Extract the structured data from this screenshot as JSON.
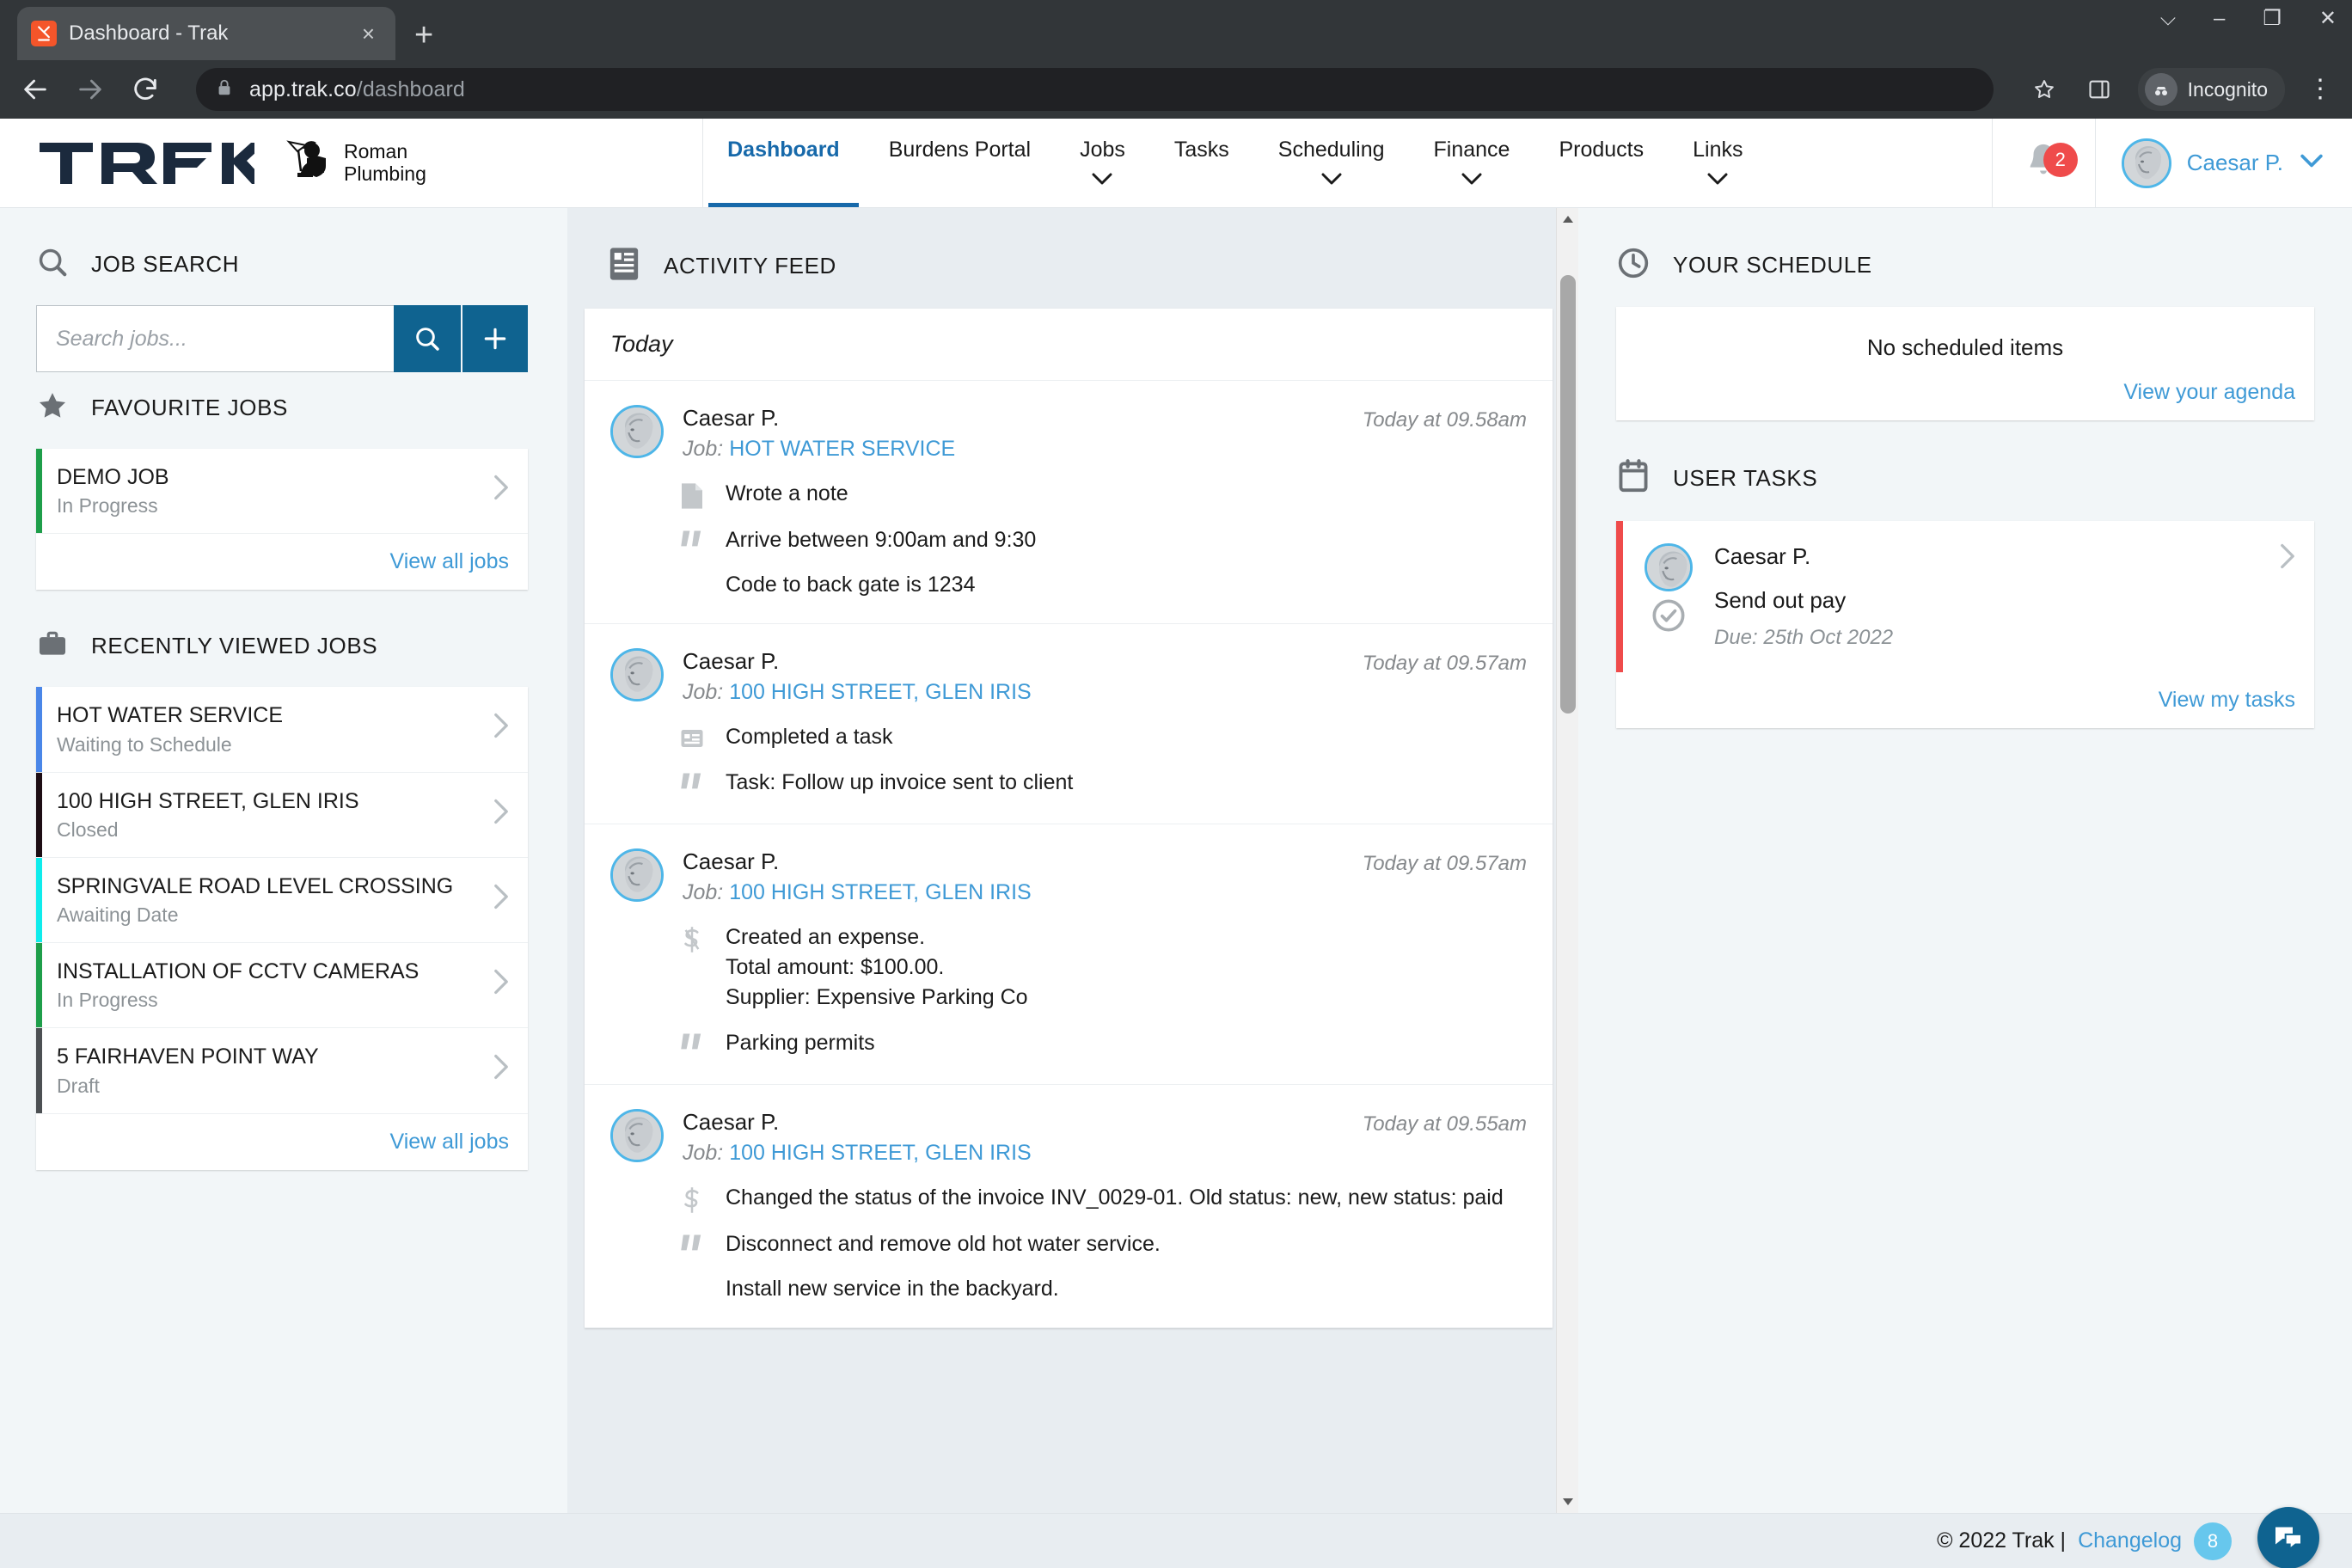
{
  "browser": {
    "tab_title": "Dashboard - Trak",
    "favicon": "trak-favicon",
    "new_tab_label": "+",
    "close_label": "×",
    "url_host": "app.trak.co",
    "url_path": "/dashboard",
    "profile_label": "Incognito",
    "win_minimize": "–",
    "win_maximize": "❐",
    "win_close": "✕",
    "win_collapse": "⌵"
  },
  "header": {
    "logo_text": "TRAK",
    "company_line1": "Roman",
    "company_line2": "Plumbing",
    "nav": [
      {
        "label": "Dashboard",
        "chevron": false,
        "active": true
      },
      {
        "label": "Burdens Portal",
        "chevron": false,
        "active": false
      },
      {
        "label": "Jobs",
        "chevron": true,
        "active": false
      },
      {
        "label": "Tasks",
        "chevron": false,
        "active": false
      },
      {
        "label": "Scheduling",
        "chevron": true,
        "active": false
      },
      {
        "label": "Finance",
        "chevron": true,
        "active": false
      },
      {
        "label": "Products",
        "chevron": false,
        "active": false
      },
      {
        "label": "Links",
        "chevron": true,
        "active": false
      }
    ],
    "notification_count": "2",
    "user_name": "Caesar P.",
    "user_chevron": "⌄",
    "accent_blue": "#1769aa",
    "link_blue": "#3f9ad6",
    "badge_red": "#ef4b4b"
  },
  "sidebar": {
    "job_search": {
      "title": "JOB SEARCH",
      "placeholder": "Search jobs...",
      "search_button": "search-icon",
      "add_button": "+"
    },
    "favourite_jobs": {
      "title": "FAVOURITE JOBS",
      "items": [
        {
          "name": "DEMO JOB",
          "status": "In Progress",
          "color": "#1e9e4a"
        }
      ],
      "view_all": "View all jobs"
    },
    "recently_viewed": {
      "title": "RECENTLY VIEWED JOBS",
      "items": [
        {
          "name": "HOT WATER SERVICE",
          "status": "Waiting to Schedule",
          "color": "#4a86e8"
        },
        {
          "name": "100 HIGH STREET, GLEN IRIS",
          "status": "Closed",
          "color": "#1d0d14"
        },
        {
          "name": "SPRINGVALE ROAD LEVEL CROSSING",
          "status": "Awaiting Date",
          "color": "#0fecec"
        },
        {
          "name": "INSTALLATION OF CCTV CAMERAS",
          "status": "In Progress",
          "color": "#1e9e4a"
        },
        {
          "name": "5 FAIRHAVEN POINT WAY",
          "status": "Draft",
          "color": "#4c5053"
        }
      ],
      "view_all": "View all jobs"
    }
  },
  "activity_feed": {
    "title": "ACTIVITY FEED",
    "day_label": "Today",
    "job_prefix": "Job:",
    "items": [
      {
        "user": "Caesar P.",
        "job": "HOT WATER SERVICE",
        "time": "Today at 09.58am",
        "action_icon": "note-icon",
        "action": "Wrote a note",
        "quote_icon": "quote-icon",
        "quote": "Arrive between 9:00am and 9:30",
        "extra": "Code to back gate is 1234"
      },
      {
        "user": "Caesar P.",
        "job": "100 HIGH STREET, GLEN IRIS",
        "time": "Today at 09.57am",
        "action_icon": "task-icon",
        "action": "Completed a task",
        "quote_icon": "quote-icon",
        "quote": "Task: Follow up invoice sent to client",
        "extra": ""
      },
      {
        "user": "Caesar P.",
        "job": "100 HIGH STREET, GLEN IRIS",
        "time": "Today at 09.57am",
        "action_icon": "expense-icon",
        "action": "Created an expense.",
        "action_line2": "Total amount: $100.00.",
        "action_line3": "Supplier: Expensive Parking Co",
        "quote_icon": "quote-icon",
        "quote": "Parking permits",
        "extra": ""
      },
      {
        "user": "Caesar P.",
        "job": "100 HIGH STREET, GLEN IRIS",
        "time": "Today at 09.55am",
        "action_icon": "dollar-icon",
        "action": "Changed the status of the invoice INV_0029-01. Old status: new, new status: paid",
        "quote_icon": "quote-icon",
        "quote": "Disconnect and remove old hot water service.",
        "extra": "Install new service in the backyard."
      }
    ]
  },
  "schedule": {
    "title": "YOUR SCHEDULE",
    "empty_text": "No scheduled items",
    "view_link": "View your agenda"
  },
  "user_tasks": {
    "title": "USER TASKS",
    "items": [
      {
        "user": "Caesar P.",
        "task": "Send out pay",
        "due": "Due: 25th Oct 2022",
        "bar_color": "#ef4b4b"
      }
    ],
    "view_link": "View my tasks"
  },
  "footer": {
    "copyright": "© 2022 Trak |",
    "changelog_label": "Changelog",
    "changelog_count": "8",
    "chat_icon": "chat-bubbles-icon"
  }
}
